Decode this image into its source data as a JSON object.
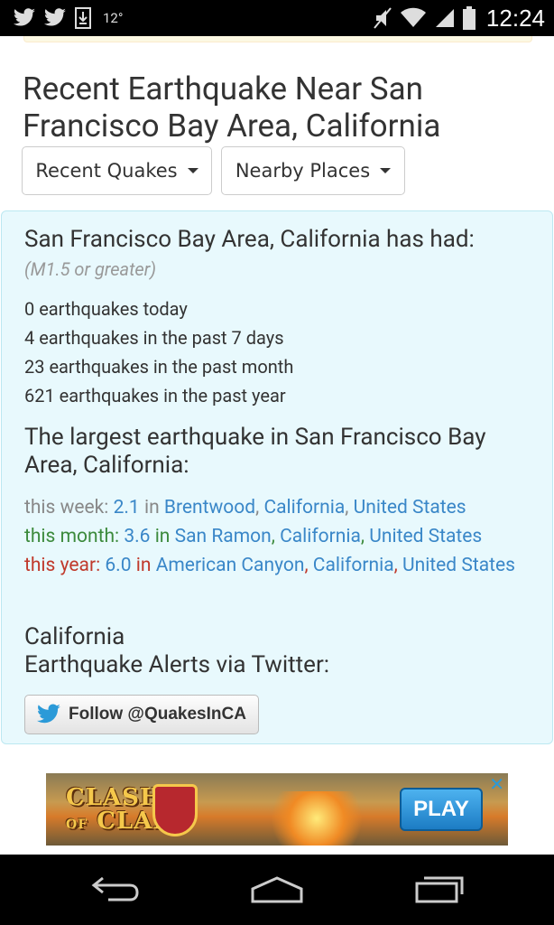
{
  "status_bar": {
    "temperature": "12°",
    "time": "12:24",
    "icons": [
      "twitter-icon",
      "twitter-icon",
      "download-icon",
      "mute-icon",
      "wifi-icon",
      "signal-icon",
      "battery-icon"
    ]
  },
  "page": {
    "title": "Recent Earthquake Near San Francisco Bay Area, California",
    "dropdowns": {
      "recent_quakes": "Recent Quakes",
      "nearby_places": "Nearby Places"
    }
  },
  "summary": {
    "heading": "San Francisco Bay Area, California has had:",
    "magnitude_note": "(M1.5 or greater)",
    "counts": [
      "0 earthquakes today",
      "4 earthquakes in the past 7 days",
      "23 earthquakes in the past month",
      "621 earthquakes in the past year"
    ]
  },
  "largest": {
    "heading": "The largest earthquake in San Francisco Bay Area, California:",
    "week": {
      "label": "this week:",
      "magnitude": "2.1",
      "in": "in",
      "place": "Brentwood",
      "state": "California",
      "country": "United States"
    },
    "month": {
      "label": "this month:",
      "magnitude": "3.6",
      "in": "in",
      "place": "San Ramon",
      "state": "California",
      "country": "United States"
    },
    "year": {
      "label": "this year:",
      "magnitude": "6.0",
      "in": "in",
      "place": "American Canyon",
      "state": "California",
      "country": "United States"
    }
  },
  "twitter": {
    "heading_line1": "California",
    "heading_line2": "Earthquake Alerts via Twitter:",
    "follow_label": "Follow @QuakesInCA"
  },
  "ad": {
    "logo_line1": "CLASH",
    "logo_of": "OF",
    "logo_line2": "CLANS",
    "play_label": "PLAY",
    "close_symbol": "✕"
  },
  "colors": {
    "panel_bg": "#e8f9fd",
    "link": "#3a87c8",
    "week_label": "#888888",
    "month_label": "#3c8a3c",
    "year_label": "#c0392b"
  }
}
